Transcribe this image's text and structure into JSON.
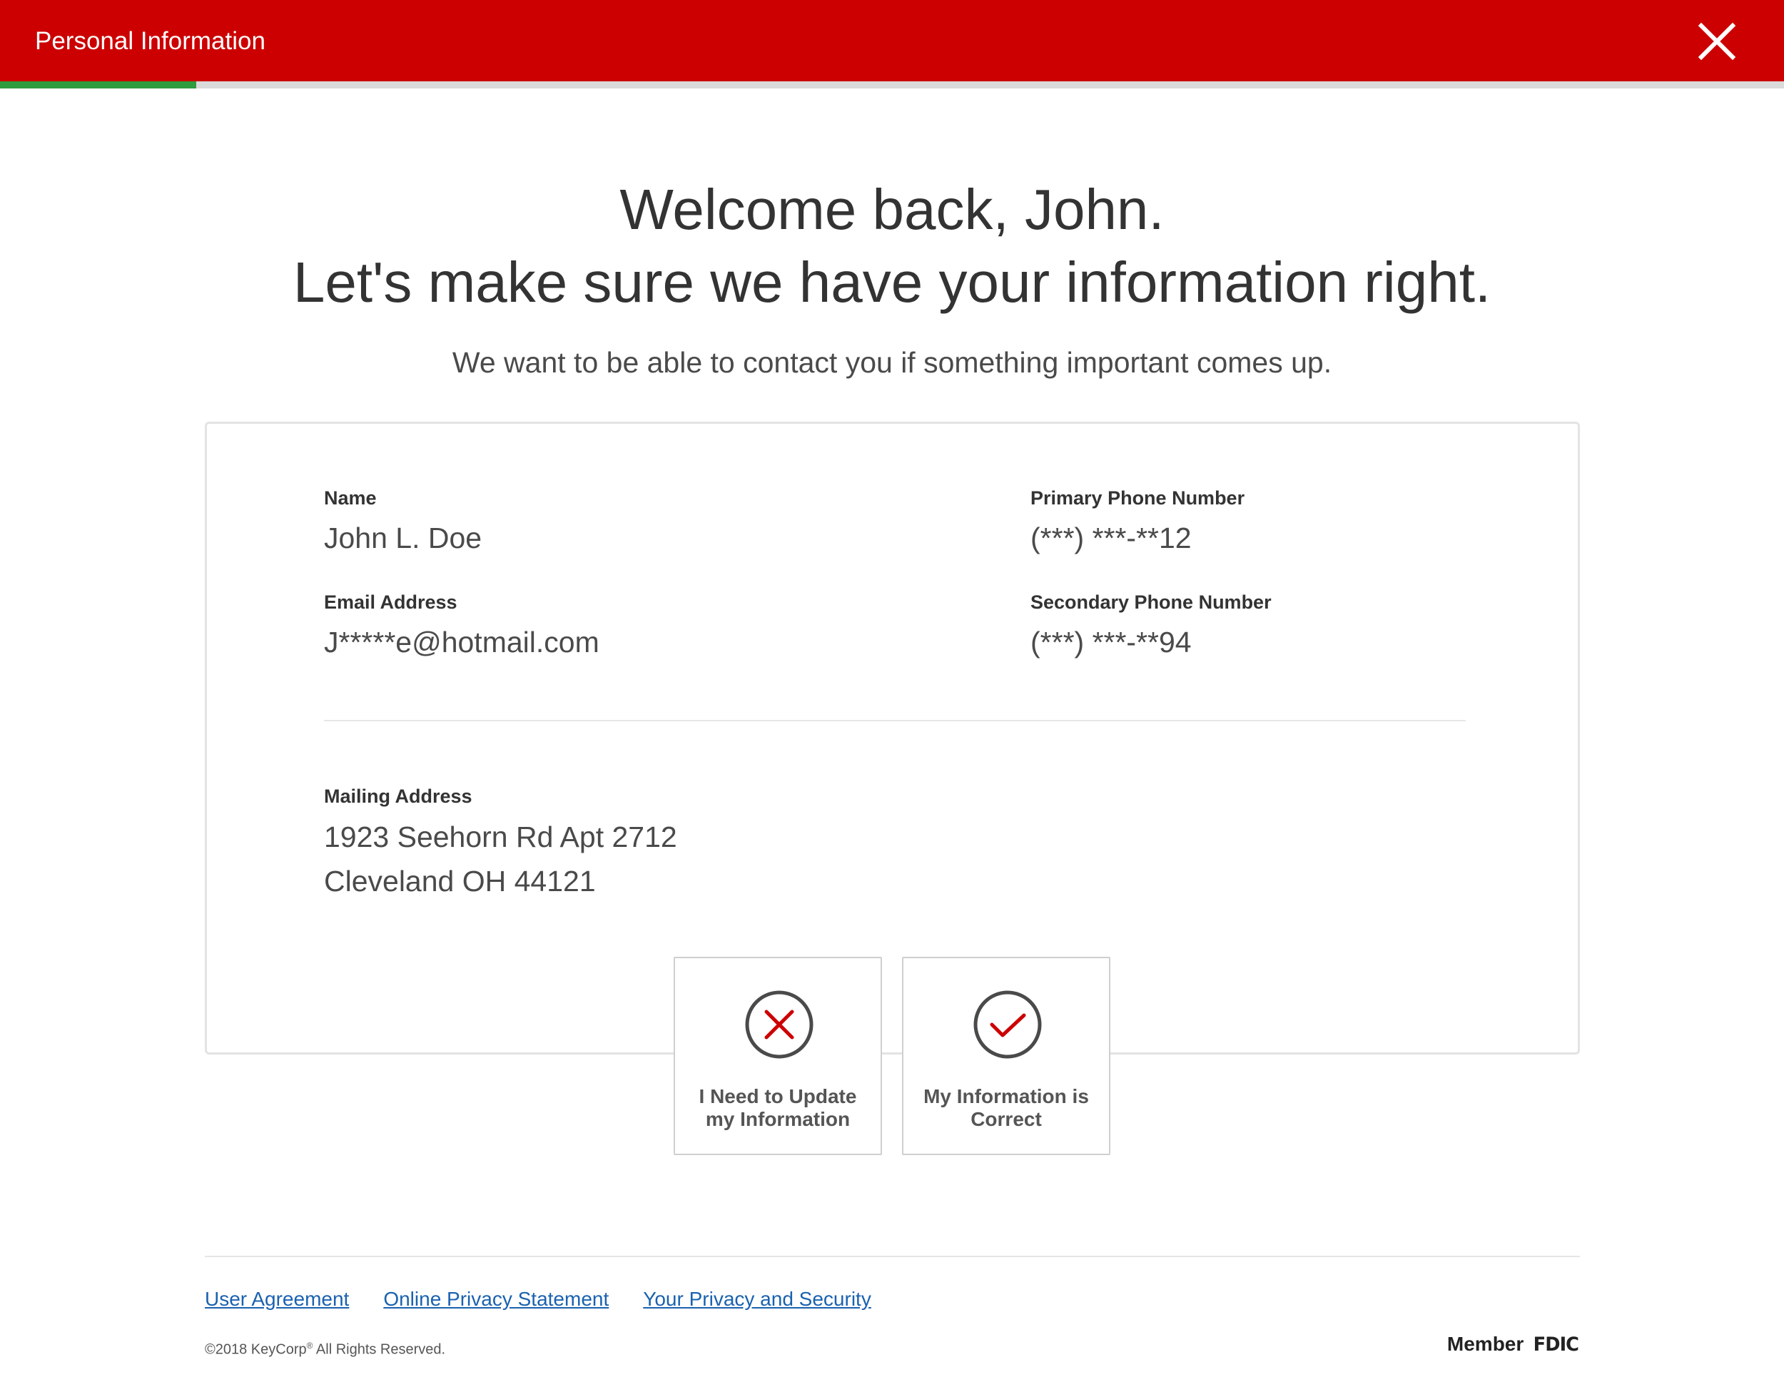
{
  "header": {
    "title": "Personal Information",
    "close_icon": "close-icon",
    "progress": 0.11,
    "colors": {
      "bar": "#cc0000",
      "progress_fill": "#2e9c3f",
      "progress_track": "#dadada"
    }
  },
  "intro": {
    "greeting": "Welcome back, John.",
    "headline": "Let's make sure we have your information right.",
    "subtitle": "We want to be able to contact you if something important comes up."
  },
  "info": {
    "name_label": "Name",
    "name_value": "John L. Doe",
    "email_label": "Email Address",
    "email_value": "J*****e@hotmail.com",
    "primary_phone_label": "Primary Phone Number",
    "primary_phone_value": "(***) ***-**12",
    "secondary_phone_label": "Secondary Phone Number",
    "secondary_phone_value": "(***) ***-**94",
    "mailing_label": "Mailing Address",
    "mailing_line1": "1923 Seehorn Rd Apt 2712",
    "mailing_line2": "Cleveland OH 44121"
  },
  "actions": {
    "update": {
      "label": "I Need to Update my Information",
      "icon": "x-circle-icon",
      "color": "#cc0000"
    },
    "correct": {
      "label": "My Information is Correct",
      "icon": "check-circle-icon",
      "color": "#cc0000"
    }
  },
  "footer": {
    "links": [
      "User Agreement",
      "Online Privacy Statement",
      "Your Privacy and Security"
    ],
    "copyright_prefix": "©2018 KeyCorp",
    "copyright_mark": "®",
    "copyright_suffix": " All Rights Reserved.",
    "member_label": "Member",
    "fdic_label": "FDIC"
  }
}
